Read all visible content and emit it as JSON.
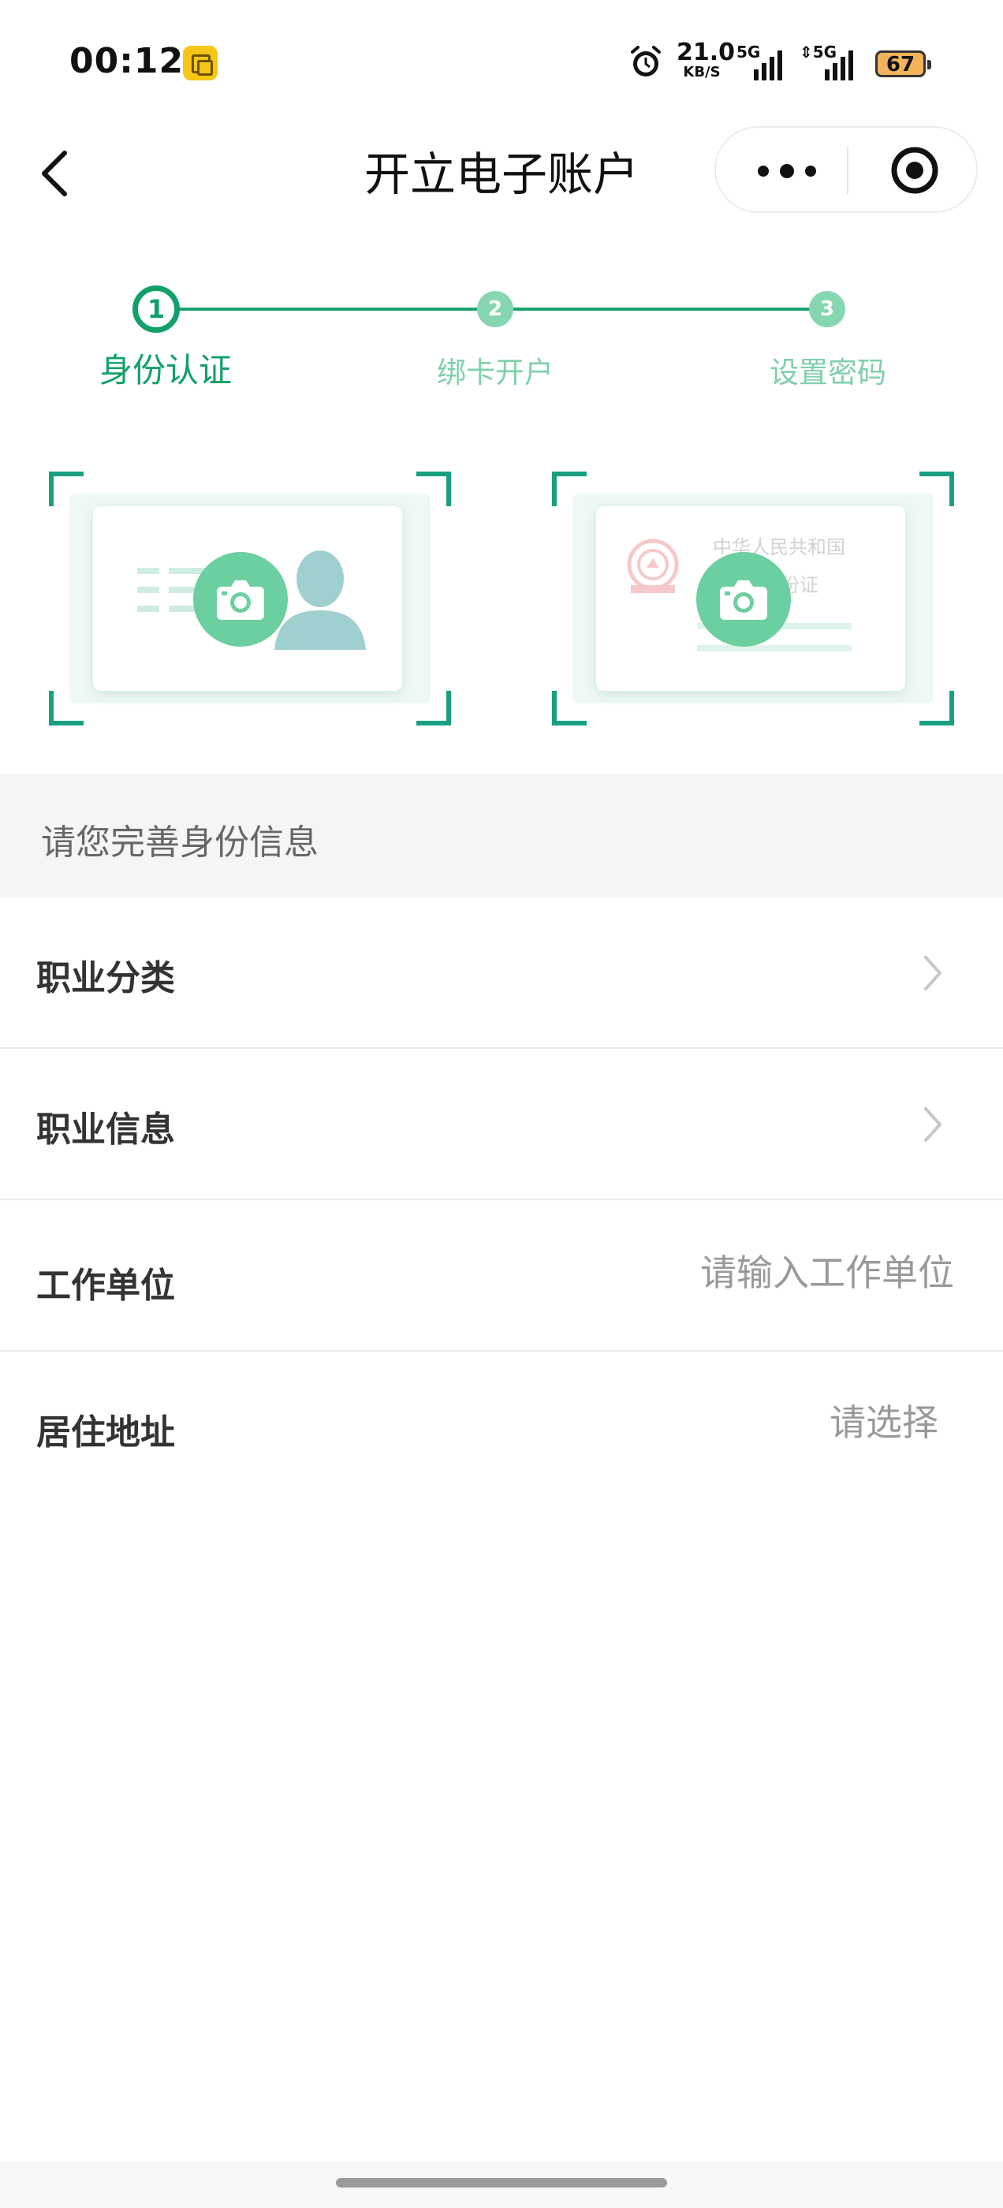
{
  "status_bar": {
    "time": "00:12",
    "net_speed_value": "21.0",
    "net_speed_unit": "KB/S",
    "signal1_label": "5G",
    "signal2_label": "5G",
    "battery": "67",
    "icons": [
      "app-notification-icon",
      "alarm-icon",
      "signal-icon",
      "battery-icon"
    ]
  },
  "nav": {
    "title": "开立电子账户",
    "icons": [
      "back-icon",
      "more-icon",
      "target-icon"
    ]
  },
  "steps": [
    {
      "number": "1",
      "label": "身份认证",
      "state": "active"
    },
    {
      "number": "2",
      "label": "绑卡开户",
      "state": "inactive"
    },
    {
      "number": "3",
      "label": "设置密码",
      "state": "inactive"
    }
  ],
  "id_cards": {
    "back_line1": "中华人民共和国",
    "back_line2": "居民身份证",
    "icons": [
      "camera-icon",
      "portrait-icon",
      "national-emblem-icon"
    ]
  },
  "section_header": "请您完善身份信息",
  "form": {
    "occupation_category": {
      "label": "职业分类"
    },
    "occupation_info": {
      "label": "职业信息"
    },
    "employer": {
      "label": "工作单位",
      "placeholder": "请输入工作单位"
    },
    "address": {
      "label": "居住地址",
      "placeholder": "请选择"
    }
  },
  "colors": {
    "primary": "#12a06a",
    "step_inactive": "#85d6b1",
    "camera": "#6ccf9f",
    "corner": "#1aa080",
    "section_bg": "#f5f5f5"
  }
}
